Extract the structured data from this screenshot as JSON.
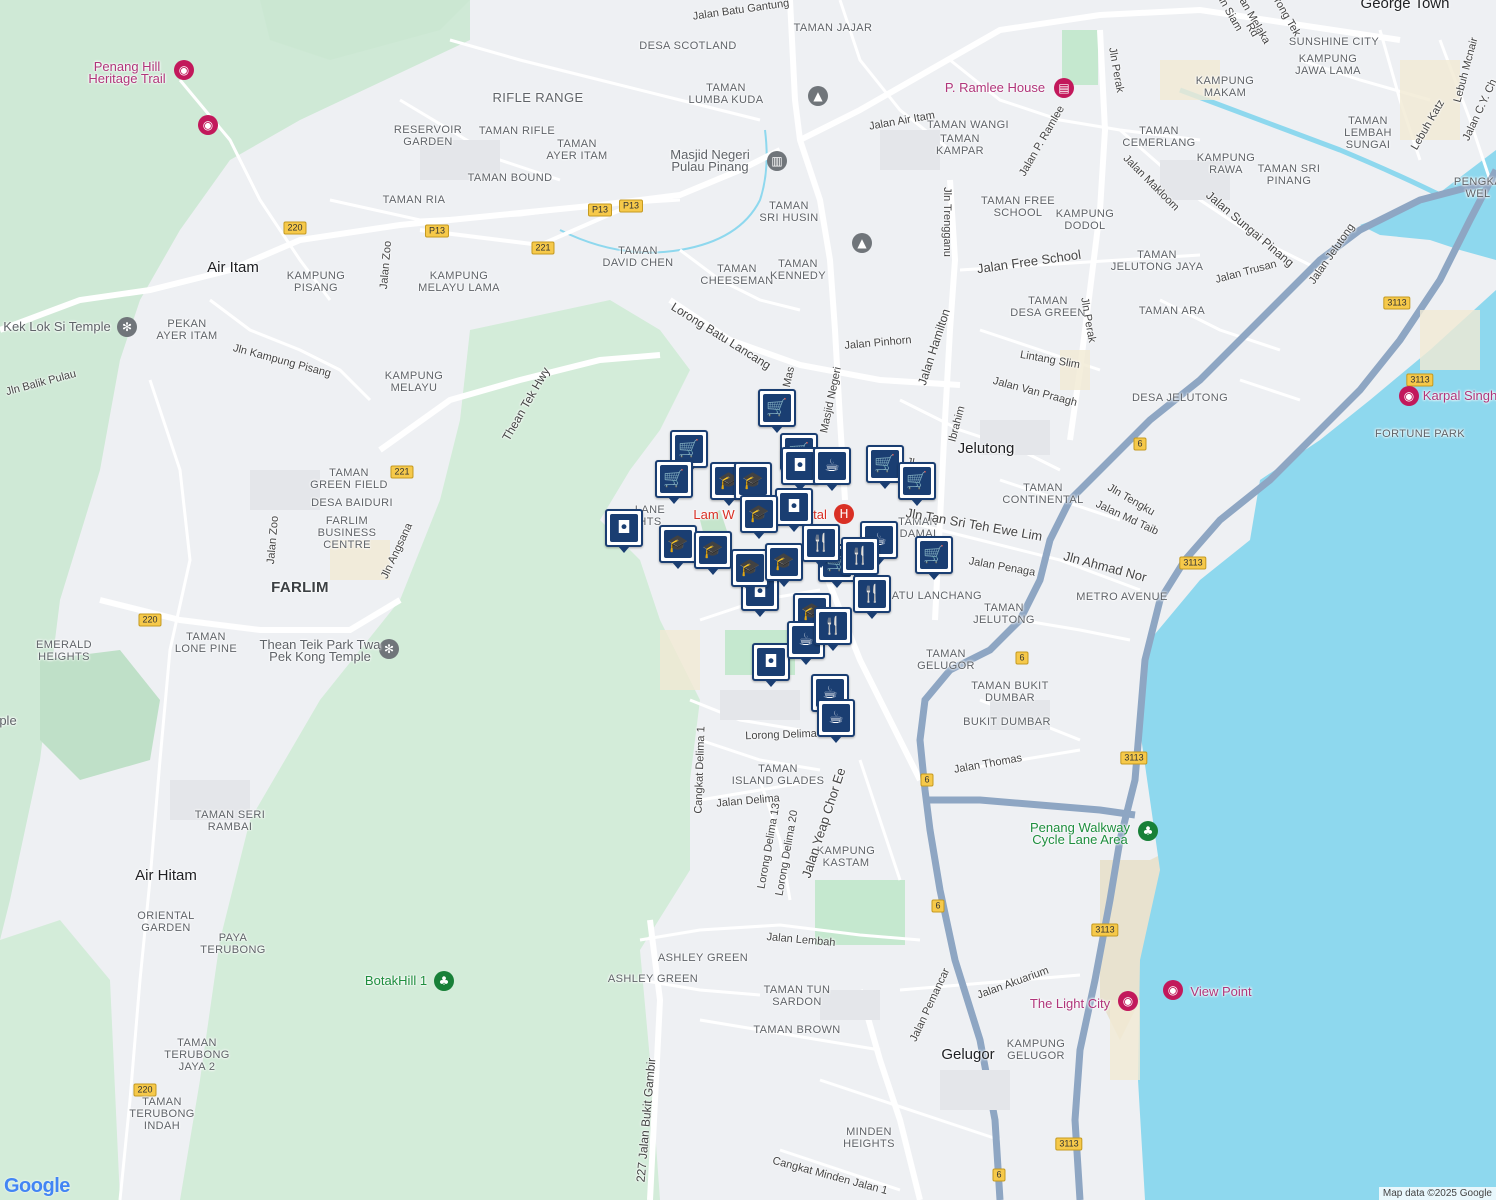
{
  "colors": {
    "land": "#eef0f3",
    "park": "#cdebd6",
    "forest": "#d8efdf",
    "water": "#8ed8ee",
    "road": "#ffffff",
    "highway": "#8ea6c3",
    "pin": "#1a3e72"
  },
  "labels": {
    "george_town": "George Town",
    "jelutong": "Jelutong",
    "air_itam": "Air Itam",
    "farlim": "FARLIM",
    "air_hitam": "Air Hitam",
    "gelugor": "Gelugor",
    "desa_scotland": "DESA SCOTLAND",
    "taman_jajar": "TAMAN JAJAR",
    "rifle_range": "RIFLE RANGE",
    "taman_lumba_kuda": "TAMAN\nLUMBA KUDA",
    "reservoir_garden": "RESERVOIR\nGARDEN",
    "taman_rifle": "TAMAN RIFLE",
    "taman_ayer_itam": "TAMAN\nAYER ITAM",
    "taman_bound": "TAMAN BOUND",
    "taman_ria": "TAMAN RIA",
    "taman_sri_husin": "TAMAN\nSRI HUSIN",
    "taman_david_chen": "TAMAN\nDAVID CHEN",
    "taman_cheeseman": "TAMAN\nCHEESEMAN",
    "taman_kennedy": "TAMAN\nKENNEDY",
    "kampung_pisang": "KAMPUNG\nPISANG",
    "kampung_melayu_lama": "KAMPUNG\nMELAYU LAMA",
    "pekan_ayer_itam": "PEKAN\nAYER ITAM",
    "kampung_melayu": "KAMPUNG\nMELAYU",
    "taman_green_field": "TAMAN\nGREEN FIELD",
    "desa_baiduri": "DESA BAIDURI",
    "farlim_business_centre": "FARLIM\nBUSINESS\nCENTRE",
    "taman_lone_pine": "TAMAN\nLONE PINE",
    "emerald_heights": "EMERALD\nHEIGHTS",
    "taman_seri_rambai": "TAMAN SERI\nRAMBAI",
    "oriental_garden": "ORIENTAL\nGARDEN",
    "paya_terubong": "PAYA\nTERUBONG",
    "taman_terubong_jaya_2": "TAMAN\nTERUBONG\nJAYA 2",
    "taman_terubong_indah": "TAMAN\nTERUBONG\nINDAH",
    "taman_wangi": "TAMAN WANGI",
    "taman_kampar": "TAMAN\nKAMPAR",
    "taman_free_school": "TAMAN FREE\nSCHOOL",
    "kampung_dodol": "KAMPUNG\nDODOL",
    "taman_jelutong_jaya": "TAMAN\nJELUTONG JAYA",
    "taman_desa_green": "TAMAN\nDESA GREEN",
    "taman_ara": "TAMAN ARA",
    "desa_jelutong": "DESA JELUTONG",
    "fortune_park": "FORTUNE PARK",
    "kampung_makam": "KAMPUNG\nMAKAM",
    "sunshine_city": "SUNSHINE CITY",
    "kampung_jawa_lama": "KAMPUNG\nJAWA LAMA",
    "taman_cemerlang": "TAMAN\nCEMERLANG",
    "kampung_rawa": "KAMPUNG\nRAWA",
    "taman_sri_pinang": "TAMAN SRI\nPINANG",
    "taman_lembah_sungai": "TAMAN\nLEMBAH\nSUNGAI",
    "pengkalan_weld": "PENGKA\nWEL",
    "taman_continental": "TAMAN\nCONTINENTAL",
    "metro_avenue": "METRO AVENUE",
    "taman_damai": "TAMAN\nDAMAI",
    "batu_lanchang": "BATU LANCHANG",
    "taman_jelutong": "TAMAN\nJELUTONG",
    "taman_gelugor": "TAMAN\nGELUGOR",
    "taman_bukit_dumbar": "TAMAN BUKIT\nDUMBAR",
    "bukit_dumbar": "BUKIT DUMBAR",
    "taman_island_glades": "TAMAN\nISLAND GLADES",
    "kampung_kastam": "KAMPUNG\nKASTAM",
    "ashley_green_1": "ASHLEY GREEN",
    "ashley_green_2": "ASHLEY GREEN",
    "taman_tun_sardon": "TAMAN TUN\nSARDON",
    "taman_brown": "TAMAN BROWN",
    "kampung_gelugor": "KAMPUNG\nGELUGOR",
    "minden_heights": "MINDEN\nHEIGHTS",
    "island_heights": "LANE\nHTS"
  },
  "roads": {
    "jalan_batu_gantung": "Jalan Batu Gantung",
    "jalan_air_itam": "Jalan Air Itam",
    "jln_perak_1": "Jln Perak",
    "jln_perak_2": "Jln Perak",
    "jalan_p_ramlee": "Jalan P. Ramlee",
    "jln_trengganu": "Jln Trengganu",
    "jalan_free_school": "Jalan Free School",
    "jalan_makloom": "Jalan Makloom",
    "jalan_sungai_pinang": "Jalan Sungai Pinang",
    "jalan_trusan": "Jalan Trusan",
    "jalan_jelutong": "Jalan Jelutong",
    "lorong_batu_lancang": "Lorong Batu Lancang",
    "jalan_pinhorn": "Jalan Pinhorn",
    "jalan_hamilton": "Jalan Hamilton",
    "lintang_slim": "Lintang Slim",
    "jalan_van_praagh": "Jalan Van Praagh",
    "masjid_negeri": "Masjid Negeri",
    "mas": "Mas",
    "jalan_zoo_1": "Jalan Zoo",
    "jalan_zoo_2": "Jalan Zoo",
    "jln_kampung_pisang": "Jln Kampung Pisang",
    "jln_balik_pulau": "Jln Balik Pulau",
    "thean_tek_hwy": "Thean Tek Hwy",
    "jln_angsana": "Jln Angsana",
    "jln_tan_sri_teh_ewe_lim": "Jln Tan Sri Teh Ewe Lim",
    "jln_ahmad_nor": "Jln Ahmad Nor",
    "jalan_penaga": "Jalan Penaga",
    "jln_tengku": "Jln Tengku",
    "jalan_md_taib": "Jalan Md Taib",
    "lorong_delima": "Lorong Delima",
    "cangkat_delima_1": "Cangkat Delima 1",
    "jalan_delima": "Jalan Delima",
    "lorong_delima_13": "Lorong Delima 13",
    "lorong_delima_20": "Lorong Delima 20",
    "jalan_yeap_chor_ee": "Jalan Yeap Chor Ee",
    "jalan_thomas": "Jalan Thomas",
    "jalan_lembah": "Jalan Lembah",
    "jalan_akuarium": "Jalan Akuarium",
    "jalan_pemancar": "Jalan Pemancar",
    "jalan_bukit_gambir": "227 Jalan Bukit Gambir",
    "cangkat_minden_jalan_1": "Cangkat Minden Jalan 1",
    "lebuh_mcnair": "Lebuh Mcnair",
    "jalan_cy_choy": "Jalan C.Y. Ch",
    "lebuh_katz": "Lebuh Katz",
    "jln_siam": "Jln Siam",
    "jalan_melaka": "Jalan Melaka",
    "lorong_tek": "Lorong Tek",
    "anson_rd": "Rd",
    "ibrahim": "Ibrahim",
    "jln_lip": "Jln Jl"
  },
  "shields": {
    "p13_a": "P13",
    "p13_b": "P13",
    "p13_c": "P13",
    "r220_a": "220",
    "r220_b": "220",
    "r220_c": "220",
    "r221_a": "221",
    "r221_b": "221",
    "r6_a": "6",
    "r6_b": "6",
    "r6_c": "6",
    "r6_d": "6",
    "r6_e": "6",
    "r3113_a": "3113",
    "r3113_b": "3113",
    "r3113_c": "3113",
    "r3113_d": "3113",
    "r3113_e": "3113",
    "r3113_f": "3113"
  },
  "pois": {
    "penang_hill": "Penang Hill\nHeritage Trail",
    "p_ramlee_house": "P. Ramlee House",
    "masjid_negeri": "Masjid Negeri\nPulau Pinang",
    "kek_lok_si": "Kek Lok Si Temple",
    "thean_teik_park": "Thean Teik Park Twa\nPek Kong Temple",
    "karpal_singh": "Karpal Singh",
    "lam_wah_ee": "Lam W",
    "hospital_tail": "tal",
    "penang_walkway": "Penang Walkway\nCycle Lane Area",
    "the_light_city": "The Light City",
    "view_point": "View Point",
    "botakhill": "BotakHill 1",
    "ple": "ple"
  },
  "attribution": "Map data ©2025 Google",
  "logo": "Google"
}
